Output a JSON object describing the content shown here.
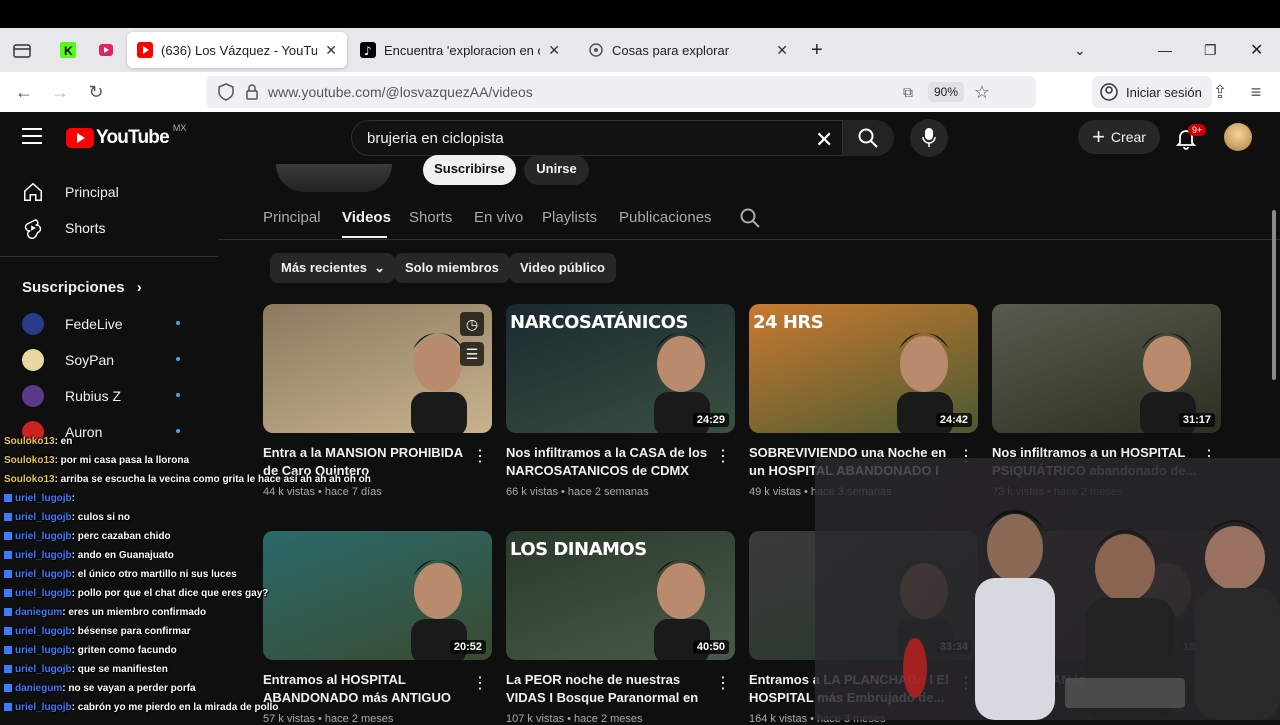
{
  "browser": {
    "tabs": [
      {
        "label": "(636) Los Vázquez - YouTube",
        "favicon": "youtube-icon",
        "active": true
      },
      {
        "label": "Encuentra 'exploracion en ciclo",
        "favicon": "tiktok-icon",
        "active": false
      },
      {
        "label": "Cosas para explorar",
        "favicon": "page-icon",
        "active": false
      }
    ],
    "url": "www.youtube.com/@losvazquezAA/videos",
    "zoom": "90%",
    "signin_label": "Iniciar sesión"
  },
  "youtube": {
    "logo_text": "YouTube",
    "country_code": "MX",
    "search_query": "brujeria en ciclopista",
    "create_label": "Crear",
    "notif_badge": "9+"
  },
  "sidebar": {
    "items": [
      {
        "label": "Principal",
        "icon": "home-icon"
      },
      {
        "label": "Shorts",
        "icon": "shorts-icon"
      }
    ],
    "subs_title": "Suscripciones",
    "subscriptions": [
      {
        "name": "FedeLive",
        "color": "#2a3a8a"
      },
      {
        "name": "SoyPan",
        "color": "#e8d7a0"
      },
      {
        "name": "Rubius Z",
        "color": "#5a3a8a"
      },
      {
        "name": "Auron",
        "color": "#cc2222"
      }
    ]
  },
  "channel": {
    "subscribe_label": "Suscribirse",
    "join_label": "Unirse",
    "tabs": [
      "Principal",
      "Videos",
      "Shorts",
      "En vivo",
      "Playlists",
      "Publicaciones"
    ],
    "active_tab": "Videos",
    "chips": [
      "Más recientes",
      "Solo miembros",
      "Video público"
    ]
  },
  "videos": [
    {
      "title": "Entra a la MANSION PROHIBIDA de Caro Quintero",
      "views": "44 k vistas",
      "age": "hace 7 días",
      "duration": "",
      "overlay": "",
      "c1": "#8a7a60",
      "c2": "#c9b38e"
    },
    {
      "title": "Nos infiltramos a la CASA de los NARCOSATANICOS de CDMX",
      "views": "66 k vistas",
      "age": "hace 2 semanas",
      "duration": "24:29",
      "overlay": "NARCOSATÁNICOS",
      "c1": "#1a2a30",
      "c2": "#3a5040"
    },
    {
      "title": "SOBREVIVIENDO una Noche en un HOSPITAL ABANDONADO I LA...",
      "views": "49 k vistas",
      "age": "hace 3 semanas",
      "duration": "24:42",
      "overlay": "24 HRS",
      "c1": "#c97a30",
      "c2": "#4a5a30"
    },
    {
      "title": "Nos infiltramos a un HOSPITAL PSIQUIÁTRICO abandonado de...",
      "views": "73 k vistas",
      "age": "hace 2 meses",
      "duration": "31:17",
      "overlay": "",
      "c1": "#5a5a50",
      "c2": "#2a3020"
    },
    {
      "title": "Entramos al HOSPITAL ABANDONADO más ANTIGUO de...",
      "views": "57 k vistas",
      "age": "hace 2 meses",
      "duration": "20:52",
      "overlay": "",
      "c1": "#2a6a6a",
      "c2": "#3a4a30"
    },
    {
      "title": "La PEOR noche de nuestras VIDAS I Bosque Paranormal en México",
      "views": "107 k vistas",
      "age": "hace 2 meses",
      "duration": "40:50",
      "overlay": "LOS DINAMOS",
      "c1": "#2a3a2a",
      "c2": "#4a5a4a"
    },
    {
      "title": "Entramos a LA PLANCHADA I El HOSPITAL más Embrujado de...",
      "views": "164 k vistas",
      "age": "hace 3 meses",
      "duration": "33:34",
      "overlay": "",
      "c1": "#3a3a3a",
      "c2": "#2a3a2a"
    },
    {
      "title": "Así HABLAN los ELEGIDOS I NUEVA...",
      "views": "",
      "age": "",
      "duration": "18:21",
      "overlay": "",
      "c1": "#4a4040",
      "c2": "#2a2a2a"
    }
  ],
  "chat": [
    {
      "user": "Souloko13",
      "msg": ": en",
      "color": "yellow"
    },
    {
      "user": "Souloko13",
      "msg": ": por mi casa pasa la llorona",
      "color": "yellow"
    },
    {
      "user": "Souloko13",
      "msg": ": arriba se escucha la vecina como grita le hace así ah ah ah oh oh",
      "color": "yellow"
    },
    {
      "user": "uriel_lugojb",
      "msg": ":",
      "color": "blue"
    },
    {
      "user": "uriel_lugojb",
      "msg": ": culos si no",
      "color": "blue"
    },
    {
      "user": "uriel_lugojb",
      "msg": ": perc cazaban chido",
      "color": "blue"
    },
    {
      "user": "uriel_lugojb",
      "msg": ": ando en Guanajuato",
      "color": "blue"
    },
    {
      "user": "uriel_lugojb",
      "msg": ": el único otro martillo ni sus luces",
      "color": "blue"
    },
    {
      "user": "uriel_lugojb",
      "msg": ": pollo por que el chat dice que eres gay?",
      "color": "blue"
    },
    {
      "user": "daniegum",
      "msg": ": eres un miembro confirmado",
      "color": "blue"
    },
    {
      "user": "uriel_lugojb",
      "msg": ": bésense para confirmar",
      "color": "blue"
    },
    {
      "user": "uriel_lugojb",
      "msg": ": griten como facundo",
      "color": "blue"
    },
    {
      "user": "uriel_lugojb",
      "msg": ": que se manifiesten",
      "color": "blue"
    },
    {
      "user": "daniegum",
      "msg": ": no se vayan a perder porfa",
      "color": "blue"
    },
    {
      "user": "uriel_lugojb",
      "msg": ": cabrón yo me pierdo en la mirada de pollo",
      "color": "blue"
    }
  ]
}
